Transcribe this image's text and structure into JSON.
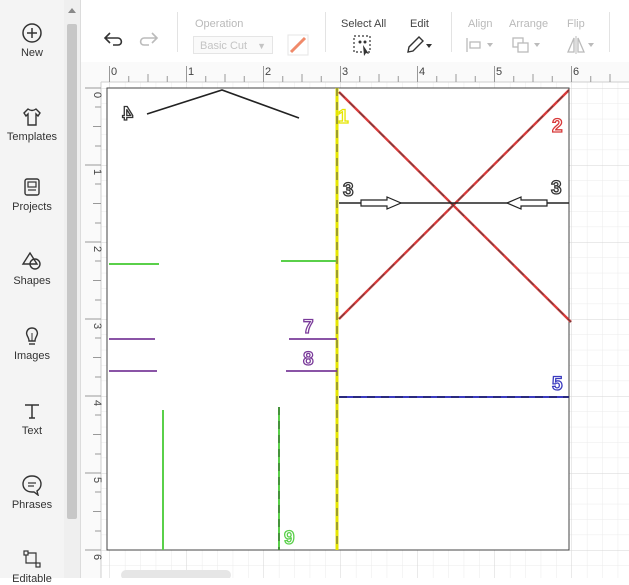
{
  "sidebar": {
    "items": [
      {
        "label": "New",
        "icon": "plus-circle-icon"
      },
      {
        "label": "Templates",
        "icon": "shirt-icon"
      },
      {
        "label": "Projects",
        "icon": "project-card-icon"
      },
      {
        "label": "Shapes",
        "icon": "shapes-icon"
      },
      {
        "label": "Images",
        "icon": "bulb-icon"
      },
      {
        "label": "Text",
        "icon": "text-t-icon"
      },
      {
        "label": "Phrases",
        "icon": "speech-bubble-icon"
      },
      {
        "label": "Editable",
        "icon": "editable-image-icon"
      }
    ]
  },
  "toolbar": {
    "operation_label": "Operation",
    "operation_value": "Basic Cut",
    "select_all_label": "Select All",
    "edit_label": "Edit",
    "align_label": "Align",
    "arrange_label": "Arrange",
    "flip_label": "Flip"
  },
  "ruler": {
    "top": [
      "0",
      "1",
      "2",
      "3",
      "4",
      "5",
      "6"
    ],
    "left": [
      "0",
      "1",
      "2",
      "3",
      "4",
      "5",
      "6"
    ]
  },
  "canvas": {
    "number_labels": [
      {
        "text": "1",
        "color": "#e6e600"
      },
      {
        "text": "2",
        "color": "#d83a3a"
      },
      {
        "text": "3",
        "color": "#333333"
      },
      {
        "text": "3",
        "color": "#333333"
      },
      {
        "text": "5",
        "color": "#3b3bbf"
      },
      {
        "text": "7",
        "color": "#7a3b9a"
      },
      {
        "text": "8",
        "color": "#7a3b9a"
      },
      {
        "text": "9",
        "color": "#5ad04a"
      }
    ],
    "mirrored_label": "4"
  },
  "colors": {
    "accent": "#2f6fd6",
    "yellow": "#e6e600",
    "red": "#d83a3a",
    "blue": "#3b3bbf",
    "green": "#5ad04a",
    "purple": "#7a3b9a"
  }
}
